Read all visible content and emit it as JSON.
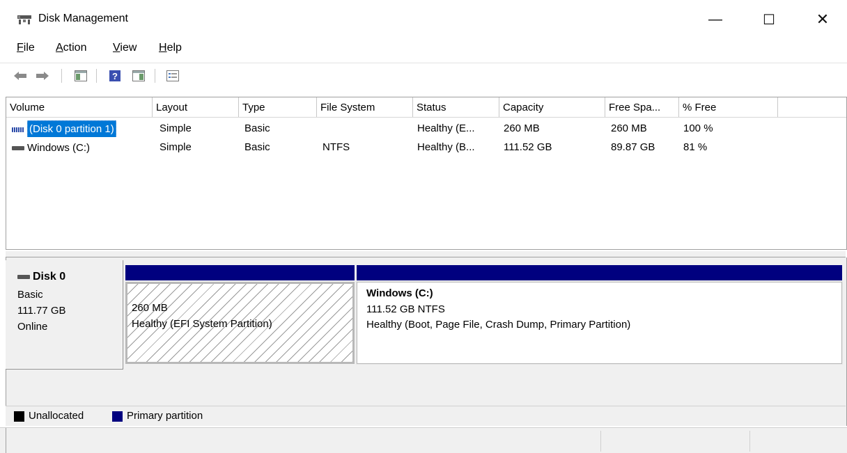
{
  "window": {
    "title": "Disk Management",
    "minimize_glyph": "—",
    "maximize_glyph": "☐",
    "close_glyph": "✕"
  },
  "menu": [
    {
      "accel": "F",
      "rest": "ile"
    },
    {
      "accel": "A",
      "rest": "ction"
    },
    {
      "accel": "V",
      "rest": "iew"
    },
    {
      "accel": "H",
      "rest": "elp"
    }
  ],
  "toolbar": {
    "icons": [
      "back-arrow-icon",
      "forward-arrow-icon",
      "show-hide-console-tree-icon",
      "help-icon",
      "show-hide-action-pane-icon",
      "properties-icon"
    ]
  },
  "volume_list": {
    "columns": [
      "Volume",
      "Layout",
      "Type",
      "File System",
      "Status",
      "Capacity",
      "Free Spa...",
      "% Free"
    ],
    "rows": [
      {
        "volume": "(Disk 0 partition 1)",
        "layout": "Simple",
        "type": "Basic",
        "file_system": "",
        "status": "Healthy (E...",
        "capacity": "260 MB",
        "free_space": "260 MB",
        "percent_free": "100 %",
        "selected": true,
        "icon": "striped-volume-icon"
      },
      {
        "volume": "Windows (C:)",
        "layout": "Simple",
        "type": "Basic",
        "file_system": "NTFS",
        "status": "Healthy (B...",
        "capacity": "111.52 GB",
        "free_space": "89.87 GB",
        "percent_free": "81 %",
        "selected": false,
        "icon": "drive-icon"
      }
    ]
  },
  "disk": {
    "name": "Disk 0",
    "type": "Basic",
    "size": "111.77 GB",
    "state": "Online",
    "partitions": [
      {
        "label": "",
        "size_fs": "260 MB",
        "status": "Healthy (EFI System Partition)"
      },
      {
        "label": "Windows  (C:)",
        "size_fs": "111.52 GB NTFS",
        "status": "Healthy (Boot, Page File, Crash Dump, Primary Partition)"
      }
    ]
  },
  "legend": [
    {
      "label": "Unallocated",
      "color": "#000000"
    },
    {
      "label": "Primary partition",
      "color": "#00007f"
    }
  ],
  "colors": {
    "primary_partition": "#00007f",
    "selection": "#0078d7"
  }
}
